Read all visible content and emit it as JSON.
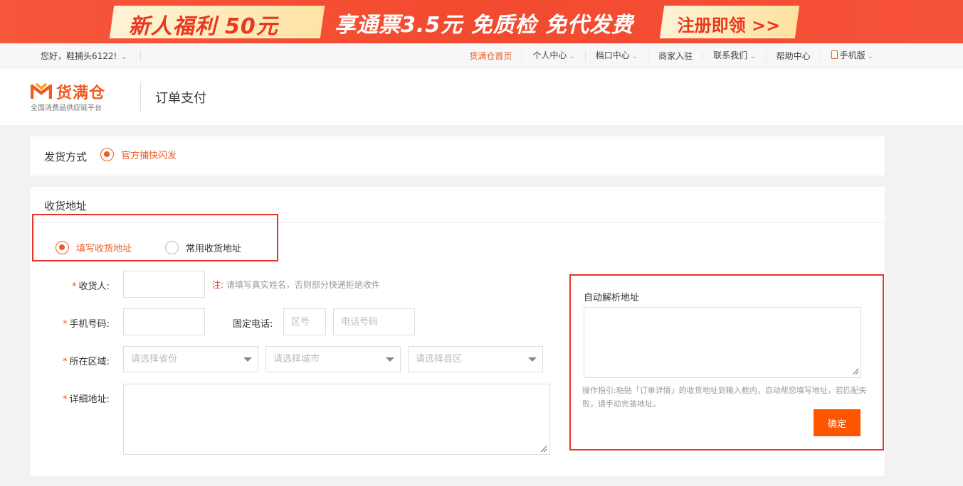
{
  "banner": {
    "offer": "新人福利 50元",
    "perks": "享通票3.5元  免质检 免代发费",
    "cta": "注册即领 >>"
  },
  "topnav": {
    "greeting": "您好，鞋捕头6122!",
    "links": [
      {
        "label": "货满仓首页"
      },
      {
        "label": "个人中心"
      },
      {
        "label": "档口中心"
      },
      {
        "label": "商家入驻"
      },
      {
        "label": "联系我们"
      },
      {
        "label": "帮助中心"
      },
      {
        "label": "手机版"
      }
    ]
  },
  "header": {
    "logo_text": "货满仓",
    "logo_sub": "全国消费品供应链平台",
    "page_title": "订单支付"
  },
  "shipping": {
    "label": "发货方式",
    "option": "官方捕快闪发"
  },
  "address": {
    "title": "收货地址",
    "tabs": [
      {
        "label": "填写收货地址",
        "selected": true
      },
      {
        "label": "常用收货地址",
        "selected": false
      }
    ],
    "fields": {
      "receiver_label": "收货人:",
      "note_key": "注:",
      "note_text": "请填写真实姓名，否则部分快递拒绝收件",
      "phone_label": "手机号码:",
      "fixed_phone_label": "固定电话:",
      "area_code_placeholder": "区号",
      "tel_placeholder": "电话号码",
      "region_label": "所在区域:",
      "province_placeholder": "请选择省份",
      "city_placeholder": "请选择城市",
      "county_placeholder": "请选择县区",
      "detail_label": "详细地址:"
    },
    "auto_parse": {
      "title": "自动解析地址",
      "help": "操作指引:粘贴「订单详情」的收货地址到输入框内，自动帮您填写地址，若匹配失败，请手动完善地址。",
      "confirm": "确定"
    }
  },
  "colors": {
    "accent": "#f15a22",
    "button": "#ff5400",
    "highlight_box": "#e8332a"
  }
}
